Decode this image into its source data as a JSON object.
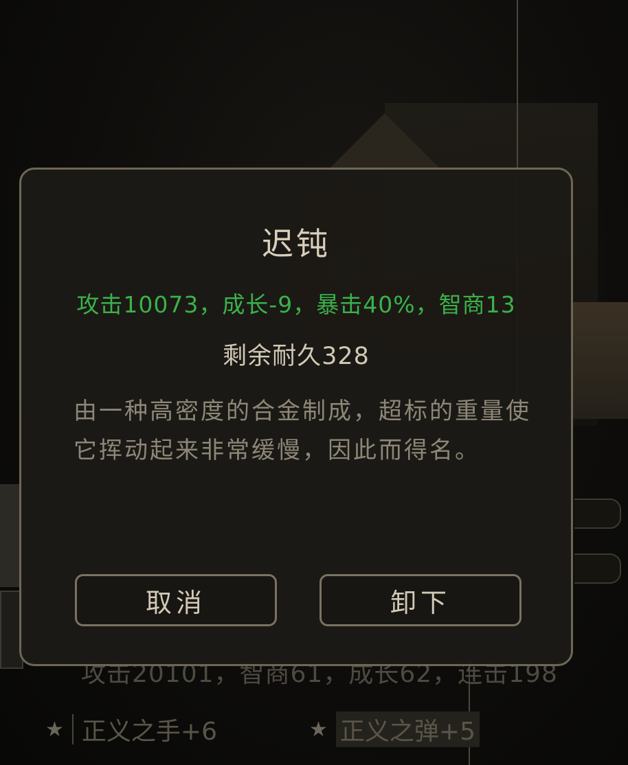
{
  "dialog": {
    "title": "迟钝",
    "stats": "攻击10073，成长-9，暴击40%，智商13",
    "durability": "剩余耐久328",
    "description": "由一种高密度的合金制成，超标的重量使它挥动起来非常缓慢，因此而得名。",
    "cancel_label": "取消",
    "unequip_label": "卸下"
  },
  "background": {
    "stat_row": "攻击20101，智商61，成长62，连击198",
    "skills": [
      {
        "name": "正义之手+6",
        "icon": "star-icon"
      },
      {
        "name": "正义之弹+5",
        "icon": "star-icon"
      }
    ]
  },
  "colors": {
    "stats_green": "#3ab24a",
    "title_text": "#d8cfbc",
    "desc_text": "#8d8778",
    "border": "#6e6755"
  }
}
